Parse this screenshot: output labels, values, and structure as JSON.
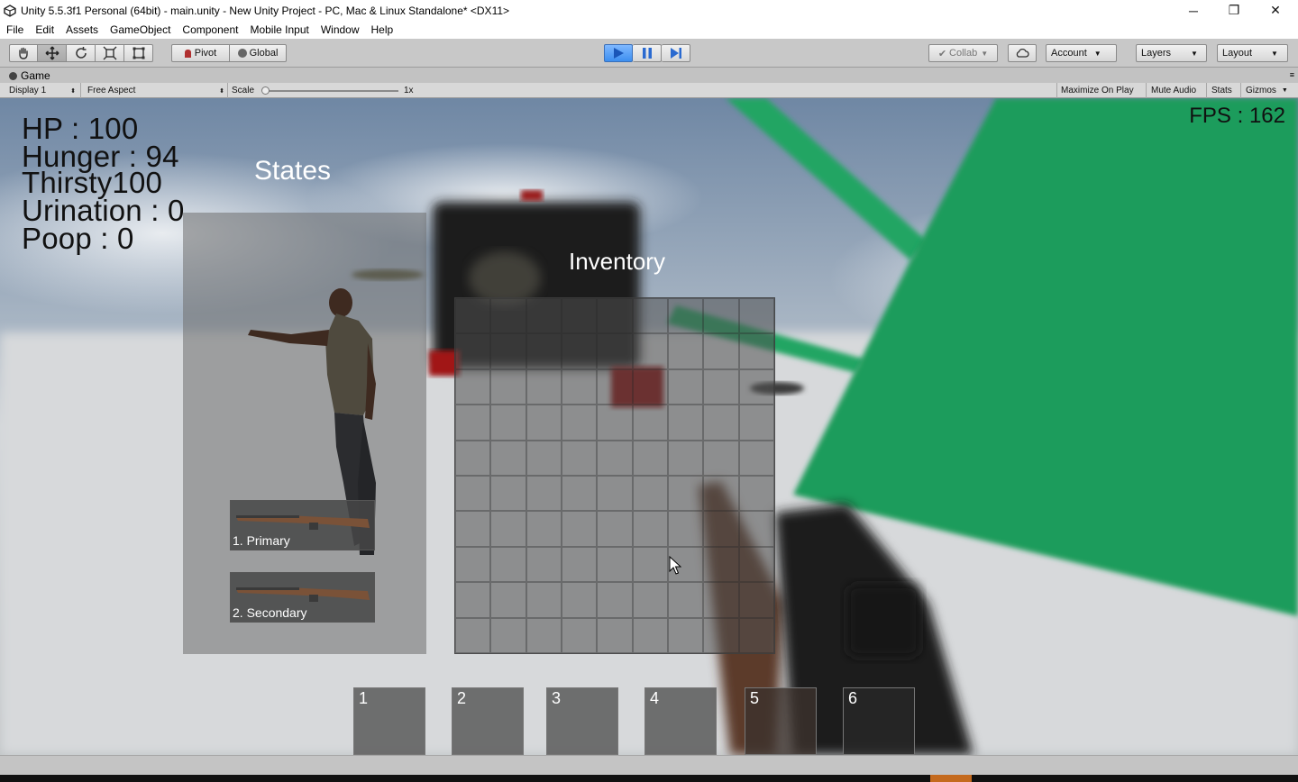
{
  "window": {
    "title": "Unity 5.5.3f1 Personal (64bit) - main.unity - New Unity Project - PC, Mac & Linux Standalone* <DX11>",
    "minimize": "─",
    "restore": "❐",
    "close": "✕"
  },
  "menu": [
    "File",
    "Edit",
    "Assets",
    "GameObject",
    "Component",
    "Mobile Input",
    "Window",
    "Help"
  ],
  "toolbar": {
    "pivot": "Pivot",
    "global": "Global",
    "collab": "Collab",
    "account": "Account",
    "layers": "Layers",
    "layout": "Layout"
  },
  "game_tab": {
    "tab_label": "Game",
    "display": "Display 1",
    "aspect": "Free Aspect",
    "scale_label": "Scale",
    "scale_value": "1x",
    "maximize_on_play": "Maximize On Play",
    "mute_audio": "Mute Audio",
    "stats": "Stats",
    "gizmos": "Gizmos"
  },
  "hud": {
    "hp": "HP : 100",
    "hunger": "Hunger : 94",
    "thirsty": "Thirsty100",
    "urination": "Urination : 0",
    "poop": "Poop : 0",
    "fps": "FPS : 162"
  },
  "states_panel": {
    "title": "States",
    "primary": "1. Primary",
    "secondary": "2. Secondary"
  },
  "inventory": {
    "title": "Inventory",
    "columns": 9,
    "rows": 10
  },
  "hotbar": [
    "1",
    "2",
    "3",
    "4",
    "5",
    "6"
  ],
  "colors": {
    "play_active": "#3d8ff0",
    "green_plane": "#1f9c5c",
    "sky": "#7f95ad"
  }
}
